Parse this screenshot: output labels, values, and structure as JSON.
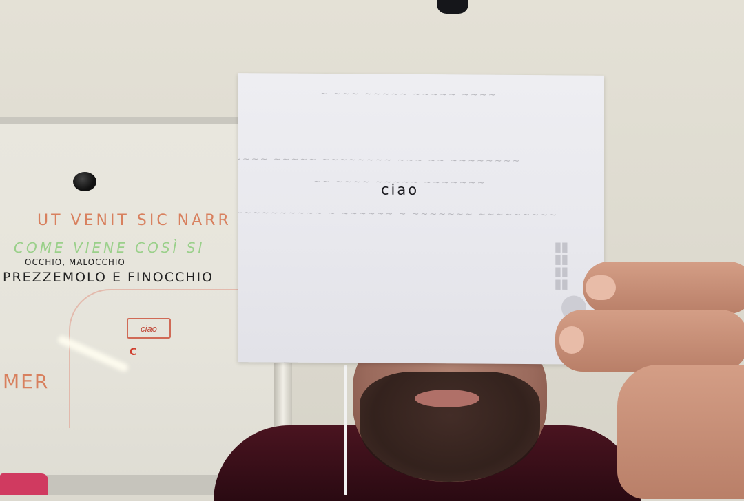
{
  "scene": {
    "paper_text": "ciao"
  },
  "whiteboard": {
    "line1": "UT VENIT SIC NARR",
    "line2": "COME VIENE COSÌ SI",
    "line3": "OCCHIO, MALOCCHIO",
    "line4": "PREZZEMOLO E FINOCCHIO",
    "line5": "MER",
    "boxed_word": "ciao",
    "small_letter": "C"
  },
  "colors": {
    "wall": "#dedbd0",
    "paper": "#ebebf0",
    "shirt": "#3a0f18",
    "whiteboard_orange_marker": "#d8805e",
    "whiteboard_green_marker": "#9ad08a"
  }
}
